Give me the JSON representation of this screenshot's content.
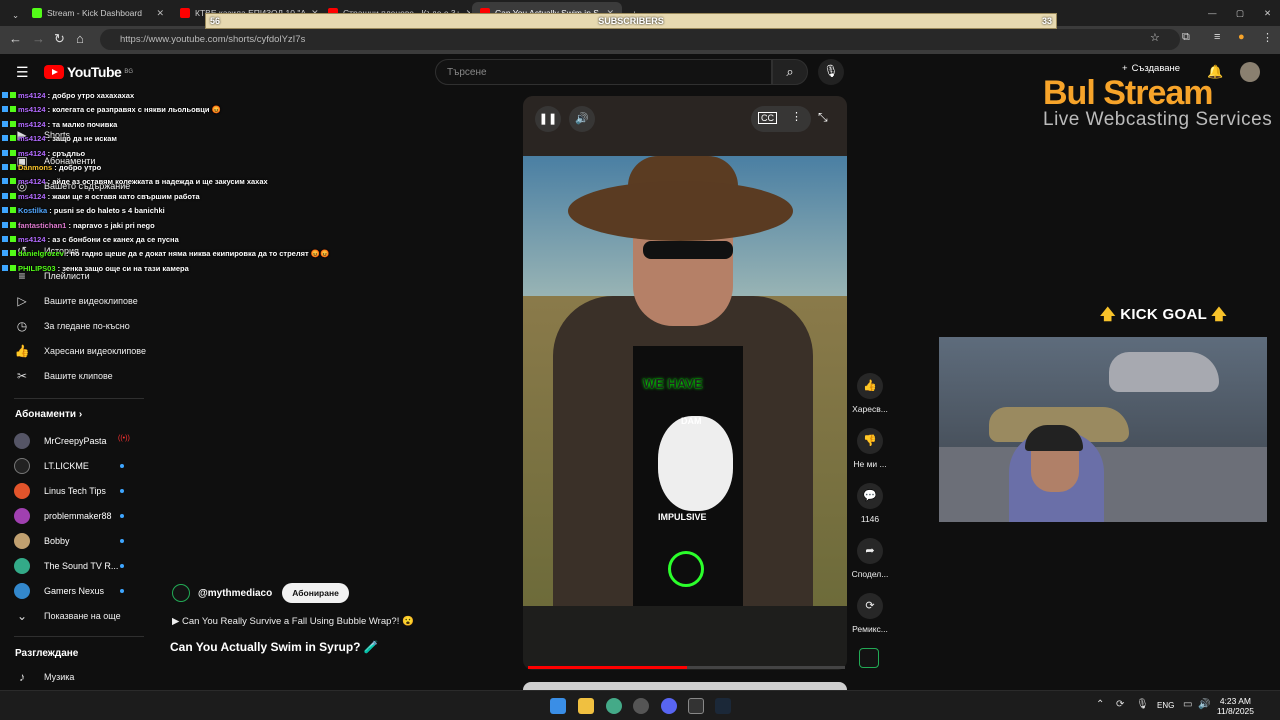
{
  "tabs": [
    {
      "title": "Stream - Kick Dashboard",
      "color": "#53fc18"
    },
    {
      "title": "КТВЕ казила ЕПИЗОД 10 \"А",
      "color": "#ff0000"
    },
    {
      "title": "Страшни пленове - Къде е 3+",
      "color": "#ff0000"
    },
    {
      "title": "Can You Actually Swim in S",
      "color": "#ff0000"
    }
  ],
  "url": "https://www.youtube.com/shorts/cyfdolYzI7s",
  "subbar": {
    "left": "56",
    "label": "SUBSCRIBERS",
    "right": "33"
  },
  "header": {
    "logo": "YouTube",
    "region": "BG",
    "search_placeholder": "Търсене",
    "create": "Създаване"
  },
  "sidebar": {
    "items": [
      {
        "label": "Shorts",
        "icon": "shorts-icon"
      },
      {
        "label": "Абонаменти",
        "icon": "subscriptions-icon"
      },
      {
        "label": "Вашето съдържание",
        "icon": "you-icon"
      },
      {
        "label": "История",
        "icon": "history-icon"
      },
      {
        "label": "Плейлисти",
        "icon": "playlist-icon"
      },
      {
        "label": "Вашите видеоклипове",
        "icon": "video-icon"
      },
      {
        "label": "За гледане по-късно",
        "icon": "clock-icon"
      },
      {
        "label": "Харесани видеоклипове",
        "icon": "like-icon"
      },
      {
        "label": "Вашите клипове",
        "icon": "scissors-icon"
      }
    ],
    "subs_heading": "Абонаменти",
    "subs": [
      {
        "name": "MrCreepyPasta",
        "color": "#556"
      },
      {
        "name": "LT.LICKME",
        "color": "#222"
      },
      {
        "name": "Linus Tech Tips",
        "color": "#e2542b"
      },
      {
        "name": "problemmaker88",
        "color": "#a040b0"
      },
      {
        "name": "Bobby",
        "color": "#c0a070"
      },
      {
        "name": "The Sound TV R...",
        "color": "#3a8"
      },
      {
        "name": "Gamers Nexus",
        "color": "#38c"
      }
    ],
    "show_more": "Показване на още",
    "explore_heading": "Разглеждане",
    "music": "Музика"
  },
  "chat": [
    {
      "user": "ms4124",
      "color": "#b36bff",
      "msg": "добро утро хахахахах"
    },
    {
      "user": "ms4124",
      "color": "#b36bff",
      "msg": "колегата се разправях с някви льольовци 😡"
    },
    {
      "user": "ms4124",
      "color": "#b36bff",
      "msg": "та малко почивка"
    },
    {
      "user": "ms4124",
      "color": "#b36bff",
      "msg": "защо да не искам"
    },
    {
      "user": "ms4124",
      "color": "#b36bff",
      "msg": "сръдльо"
    },
    {
      "user": "Danmons",
      "color": "#f7c22a",
      "msg": "добро утро"
    },
    {
      "user": "ms4124",
      "color": "#b36bff",
      "msg": "айде аз оставям колежката в надежда и ще закусим хахах"
    },
    {
      "user": "ms4124",
      "color": "#b36bff",
      "msg": "жаки ще я оставя като свършим работа"
    },
    {
      "user": "Kostilka",
      "color": "#53a8ff",
      "msg": "pusni se do haleto s 4 banichki"
    },
    {
      "user": "fantastichan1",
      "color": "#e07bd0",
      "msg": "napravo s jaki pri nego"
    },
    {
      "user": "ms4124",
      "color": "#b36bff",
      "msg": "аз с бонбони се канех да се пусна"
    },
    {
      "user": "danielgrozev",
      "color": "#53fc18",
      "msg": "по гадно щеше да е докат няма никва екипировка да то стрелят 😡😡"
    },
    {
      "user": "PHILIPS03",
      "color": "#53fc18",
      "msg": "зенка защо още си на тази камера"
    }
  ],
  "video": {
    "overlay_text": "WE HAVE",
    "shirt_text_1": "DAM",
    "shirt_text_2": "IMPULSIVE",
    "progress_pct": 50
  },
  "actions": [
    {
      "label": "Харесв...",
      "icon": "thumbs-up-icon"
    },
    {
      "label": "Не ми ...",
      "icon": "thumbs-down-icon"
    },
    {
      "label": "1146",
      "icon": "comment-icon"
    },
    {
      "label": "Сподел...",
      "icon": "share-icon"
    },
    {
      "label": "Ремикс...",
      "icon": "remix-icon"
    }
  ],
  "channel": {
    "handle": "@mythmediaco",
    "subscribe": "Абониране"
  },
  "description": "Can You Really Survive a Fall Using Bubble Wrap?! 😮",
  "title": "Can You Actually Swim in Syrup? 🧪",
  "branding": {
    "main": "Bul Stream",
    "sub": "Live Webcasting Services",
    "accent": "#f7a42a"
  },
  "kick_goal": "KICK GOAL",
  "taskbar": {
    "lang": "ENG",
    "time": "4:23 AM",
    "date": "11/8/2025"
  }
}
